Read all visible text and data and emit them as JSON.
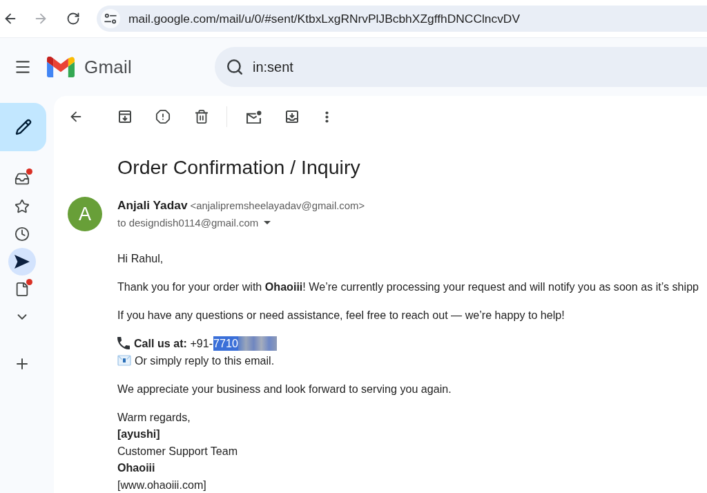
{
  "browser": {
    "nav_buttons": [
      {
        "kind": "back",
        "disabled": false
      },
      {
        "kind": "forward",
        "disabled": true
      },
      {
        "kind": "reload",
        "disabled": false
      }
    ],
    "url": "mail.google.com/mail/u/0/#sent/KtbxLxgRNrvPlJBcbhXZgffhDNCClncvDV"
  },
  "header": {
    "app_name": "Gmail",
    "search": {
      "value": "in:sent"
    }
  },
  "sidebar": {
    "items": [
      {
        "kind": "inbox",
        "selected": false,
        "notification_dot": true
      },
      {
        "kind": "starred",
        "selected": false,
        "notification_dot": false
      },
      {
        "kind": "snoozed",
        "selected": false,
        "notification_dot": false
      },
      {
        "kind": "sent",
        "selected": true,
        "notification_dot": false
      },
      {
        "kind": "drafts",
        "selected": false,
        "notification_dot": true
      },
      {
        "kind": "more",
        "selected": false,
        "notification_dot": false
      }
    ]
  },
  "message": {
    "subject": "Order Confirmation / Inquiry",
    "sender": {
      "initial": "A",
      "name": "Anjali Yadav",
      "email": "<anjalipremsheelayadav@gmail.com>"
    },
    "recipient": "to designdish0114@gmail.com",
    "body": [
      {
        "kind": "paragraph",
        "lines": [
          {
            "text": "Hi Rahul,",
            "bold": false
          }
        ]
      },
      {
        "kind": "paragraph",
        "lines": [
          {
            "text": "Thank you for your order with **Ohaoiii**! We’re currently processing your request and will notify you as soon as it’s shipp",
            "bold": false
          }
        ]
      },
      {
        "kind": "paragraph",
        "lines": [
          {
            "text": "If you have any questions or need assistance, feel free to reach out — we’re happy to help!",
            "bold": false
          }
        ]
      },
      {
        "kind": "contact",
        "phone": {
          "label": "**Call us at:** +91-",
          "digits": "7710",
          "selected": true,
          "redacted": true
        },
        "reply": "Or simply reply to this email."
      },
      {
        "kind": "paragraph",
        "lines": [
          {
            "text": "We appreciate your business and look forward to serving you again.",
            "bold": false
          }
        ]
      },
      {
        "kind": "paragraph",
        "lines": [
          {
            "text": "Warm regards,",
            "bold": false
          },
          {
            "text": "[ayushi]",
            "bold": true
          },
          {
            "text": "Customer Support Team",
            "bold": false
          },
          {
            "text": "Ohaoiii",
            "bold": true
          },
          {
            "text": "[www.ohaoiii.com]",
            "bold": false
          }
        ]
      }
    ]
  }
}
